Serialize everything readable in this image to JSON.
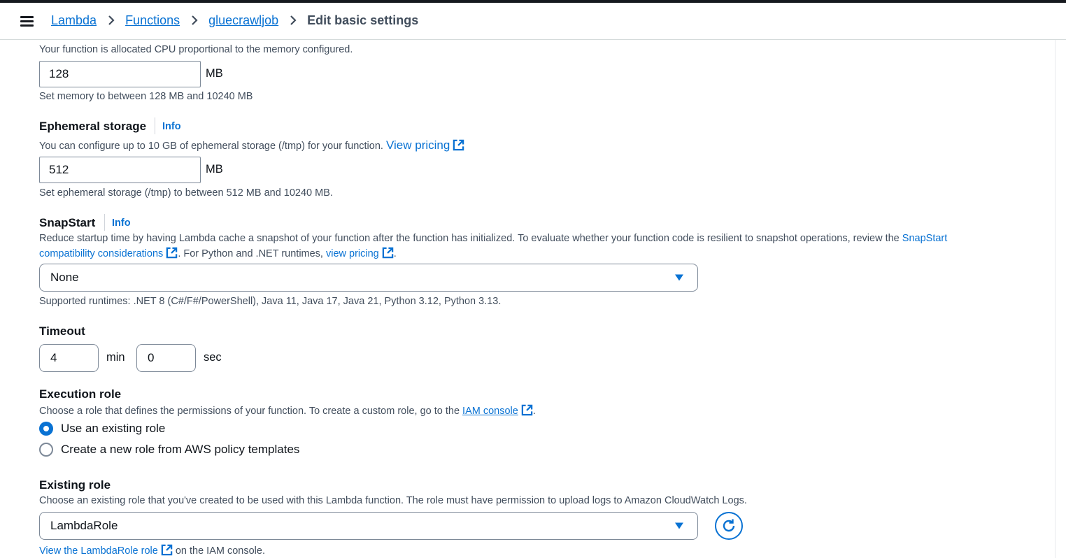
{
  "breadcrumbs": {
    "items": [
      "Lambda",
      "Functions",
      "gluecrawljob"
    ],
    "current": "Edit basic settings"
  },
  "memory": {
    "description": "Your function is allocated CPU proportional to the memory configured.",
    "value": "128",
    "unit": "MB",
    "constraint": "Set memory to between 128 MB and 10240 MB"
  },
  "ephemeral": {
    "label": "Ephemeral storage",
    "info": "Info",
    "description": "You can configure up to 10 GB of ephemeral storage (/tmp) for your function.",
    "pricing_link": "View pricing",
    "value": "512",
    "unit": "MB",
    "constraint": "Set ephemeral storage (/tmp) to between 512 MB and 10240 MB."
  },
  "snapstart": {
    "label": "SnapStart",
    "info": "Info",
    "description_1": "Reduce startup time by having Lambda cache a snapshot of your function after the function has initialized. To evaluate whether your function code is resilient to snapshot operations, review the",
    "link_1a": "SnapStart",
    "link_1b": "compatibility considerations",
    "description_2": ". For Python and .NET runtimes,",
    "link_2": "view pricing",
    "description_3": ".",
    "selected": "None",
    "supported": "Supported runtimes: .NET 8 (C#/F#/PowerShell), Java 11, Java 17, Java 21, Python 3.12, Python 3.13."
  },
  "timeout": {
    "label": "Timeout",
    "minutes": "4",
    "min_unit": "min",
    "seconds": "0",
    "sec_unit": "sec"
  },
  "execution_role": {
    "label": "Execution role",
    "description": "Choose a role that defines the permissions of your function. To create a custom role, go to the",
    "iam_link": "IAM console",
    "description_end": ".",
    "options": [
      "Use an existing role",
      "Create a new role from AWS policy templates"
    ],
    "selected_index": 0
  },
  "existing_role": {
    "label": "Existing role",
    "description": "Choose an existing role that you've created to be used with this Lambda function. The role must have permission to upload logs to Amazon CloudWatch Logs.",
    "selected": "LambdaRole",
    "view_link": "View the LambdaRole role",
    "view_suffix": "on the IAM console."
  },
  "icons": [
    "menu-icon",
    "chevron-right-icon",
    "external-link-icon",
    "caret-down-icon",
    "refresh-icon",
    "radio-icon"
  ],
  "colors": {
    "link": "#0972d3",
    "text": "#0f141a",
    "muted": "#414d5c",
    "border": "#7d8998"
  }
}
